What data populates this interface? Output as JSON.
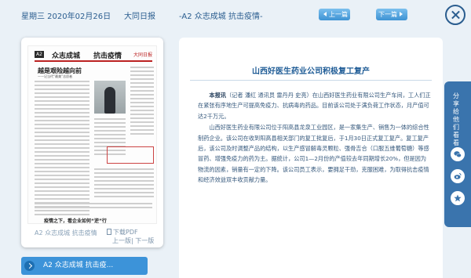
{
  "header": {
    "date": "星期三  2020年02月26日",
    "paper_name": "大同日报",
    "page_title": "-A2  众志成城  抗击疫情-",
    "prev_label": "上一篇",
    "next_label": "下一篇"
  },
  "thumbnail": {
    "tag": "A2",
    "head_left": "众志成城",
    "head_right": "抗击疫情",
    "head_date": "大同日报",
    "headline": "越是艰险越向前",
    "sub": "——记当代“最美”志愿者",
    "bottom_head": "疫情之下，看企业如何“逆”行",
    "caption": "A2  众志成城  抗击疫情",
    "pdf_label": "下载PDF",
    "prev_link": "上一版",
    "next_link": "下一版"
  },
  "section_bar": {
    "label": "A2  众志成城  抗击疫..."
  },
  "article": {
    "title": "山西好医生药业公司积极复工复产",
    "lead": "本报讯",
    "p1": "（记者 潘红 通讯员 雷丹丹 史亮）在山西好医生药业有限公司生产车间，工人们正在紧张有序地生产可提高免疫力、抗病毒的药品。目前该公司处于满负荷工作状态，月产值可达2千万元。",
    "p2": "山西好医生药业有限公司位于阳高县龙泉工业园区，是一家集生产、销售为一体的综合性制药企业。该公司在收到阳高县相关部门的复工批复后，于1月30日正式复工复产。复工复产后，该公司及时调整产品的结构，以生产感冒解毒灵颗粒、强骨吉合（口服五维葡萄糖）等感冒药、增强免疫力的药为主。据统计，公司1—2月份的产值较去年同期增长20%，但是因为物流的因素，销量有一定的下降。该公司员工表示，要拥足干劲，克服困难，为取得抗击疫情和经济效益双丰收贡献力量。"
  },
  "share": {
    "label": "分享给他们看看",
    "icons": [
      "wechat-icon",
      "weibo-icon",
      "star-icon"
    ]
  },
  "colors": {
    "accent": "#3c93d9",
    "dark_blue": "#2a5d8f",
    "share_bg": "#3a74ad",
    "bg": "#eaf1f7"
  }
}
